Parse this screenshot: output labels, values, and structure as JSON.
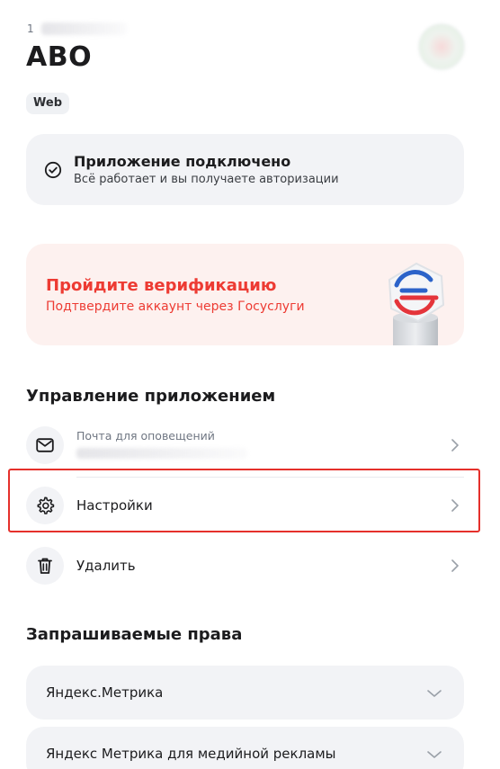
{
  "app": {
    "id_prefix": "1",
    "title": "ABO",
    "platform": "Web"
  },
  "status": {
    "title": "Приложение подключено",
    "subtitle": "Всё работает и вы получаете авторизации",
    "icon": "check-circle-icon"
  },
  "verification": {
    "title": "Пройдите верификацию",
    "subtitle": "Подтвердите аккаунт через Госуслуги",
    "accent_color": "#ed3b33",
    "background_color": "#fdf1ef",
    "icon": "gosuslugi-logo-icon"
  },
  "management": {
    "title": "Управление приложением",
    "items": [
      {
        "caption": "Почта для оповещений",
        "label": "",
        "icon": "mail-icon"
      },
      {
        "caption": "",
        "label": "Настройки",
        "icon": "gear-icon"
      },
      {
        "caption": "",
        "label": "Удалить",
        "icon": "trash-icon"
      }
    ]
  },
  "permissions": {
    "title": "Запрашиваемые права",
    "items": [
      {
        "label": "Яндекс.Метрика"
      },
      {
        "label": "Яндекс Метрика для медийной рекламы"
      }
    ]
  },
  "colors": {
    "highlight_border": "#e5302b",
    "card_background": "#f2f3f6"
  }
}
